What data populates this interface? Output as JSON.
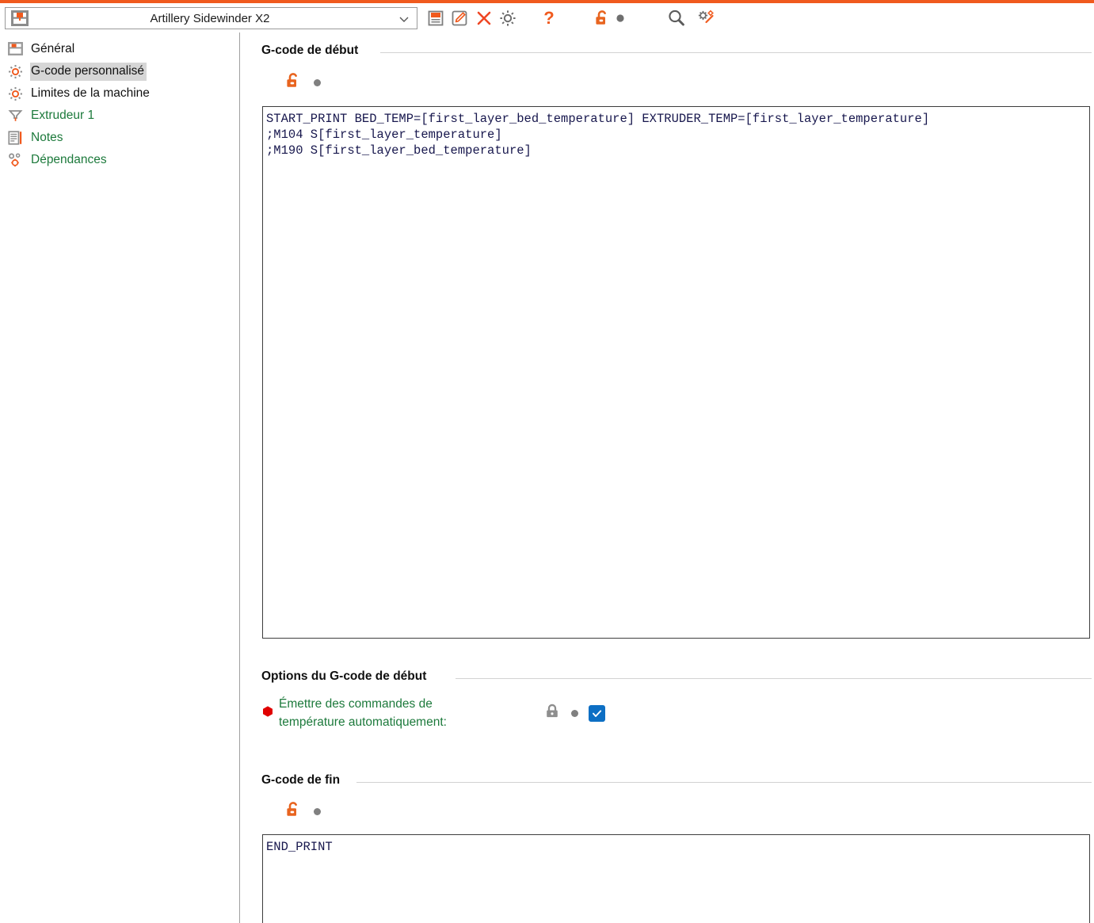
{
  "window": {
    "accent_color": "#f05a1e",
    "green_text_color": "#1d7a3c",
    "checkbox_color": "#0d6fc4"
  },
  "toolbar": {
    "preset": {
      "icon": "printer-icon",
      "value": "Artillery Sidewinder X2",
      "placeholder": "Artillery Sidewinder X2",
      "arrow_icon": "chevron-down-icon"
    },
    "buttons": [
      {
        "name": "save-preset-button",
        "icon": "floppy-disk-icon",
        "tooltip": "Enregistrer"
      },
      {
        "name": "rename-preset-button",
        "icon": "pencil-edit-icon",
        "tooltip": "Renommer"
      },
      {
        "name": "delete-preset-button",
        "icon": "cross-x-icon",
        "tooltip": "Supprimer"
      },
      {
        "name": "preset-settings-button",
        "icon": "gear-icon",
        "tooltip": "Paramètres"
      },
      {
        "name": "help-button",
        "icon": "question-mark-icon",
        "tooltip": "Aide"
      },
      {
        "name": "unlock-toggle-button",
        "icon": "unlock-orange-icon",
        "tooltip": "Déverrouiller"
      },
      {
        "name": "search-button",
        "icon": "magnifier-icon",
        "tooltip": "Rechercher"
      },
      {
        "name": "compare-presets-button",
        "icon": "gears-compare-icon",
        "tooltip": "Comparer"
      }
    ]
  },
  "sidebar": {
    "items": [
      {
        "label": "Général",
        "icon": "printer-bed-icon",
        "color": "dark",
        "selected": false
      },
      {
        "label": "G-code personnalisé",
        "icon": "gear-icon",
        "color": "dark",
        "selected": true
      },
      {
        "label": "Limites de la machine",
        "icon": "gear-icon",
        "color": "dark",
        "selected": false
      },
      {
        "label": "Extrudeur 1",
        "icon": "nozzle-icon",
        "color": "green",
        "selected": false
      },
      {
        "label": "Notes",
        "icon": "notes-icon",
        "color": "green",
        "selected": false
      },
      {
        "label": "Dépendances",
        "icon": "dependencies-icon",
        "color": "green",
        "selected": false
      }
    ]
  },
  "main": {
    "start_gcode_group": {
      "title": "G-code de début",
      "lock_icon": "unlock-orange-icon",
      "revert_dot": "gray-dot",
      "text": "START_PRINT BED_TEMP=[first_layer_bed_temperature] EXTRUDER_TEMP=[first_layer_temperature]\n;M104 S[first_layer_temperature]\n;M190 S[first_layer_bed_temperature]"
    },
    "start_gcode_options_group": {
      "title": "Options du G-code de début",
      "option": {
        "bullet_icon": "red-hexagon-bullet",
        "label": "Émettre des commandes de température automatiquement:",
        "lock_icon": "lock-closed-gray-icon",
        "revert_dot": "gray-dot",
        "checkbox_icon": "checkmark-icon",
        "checked": true
      }
    },
    "end_gcode_group": {
      "title": "G-code de fin",
      "lock_icon": "unlock-orange-icon",
      "revert_dot": "gray-dot",
      "text": "END_PRINT"
    }
  }
}
